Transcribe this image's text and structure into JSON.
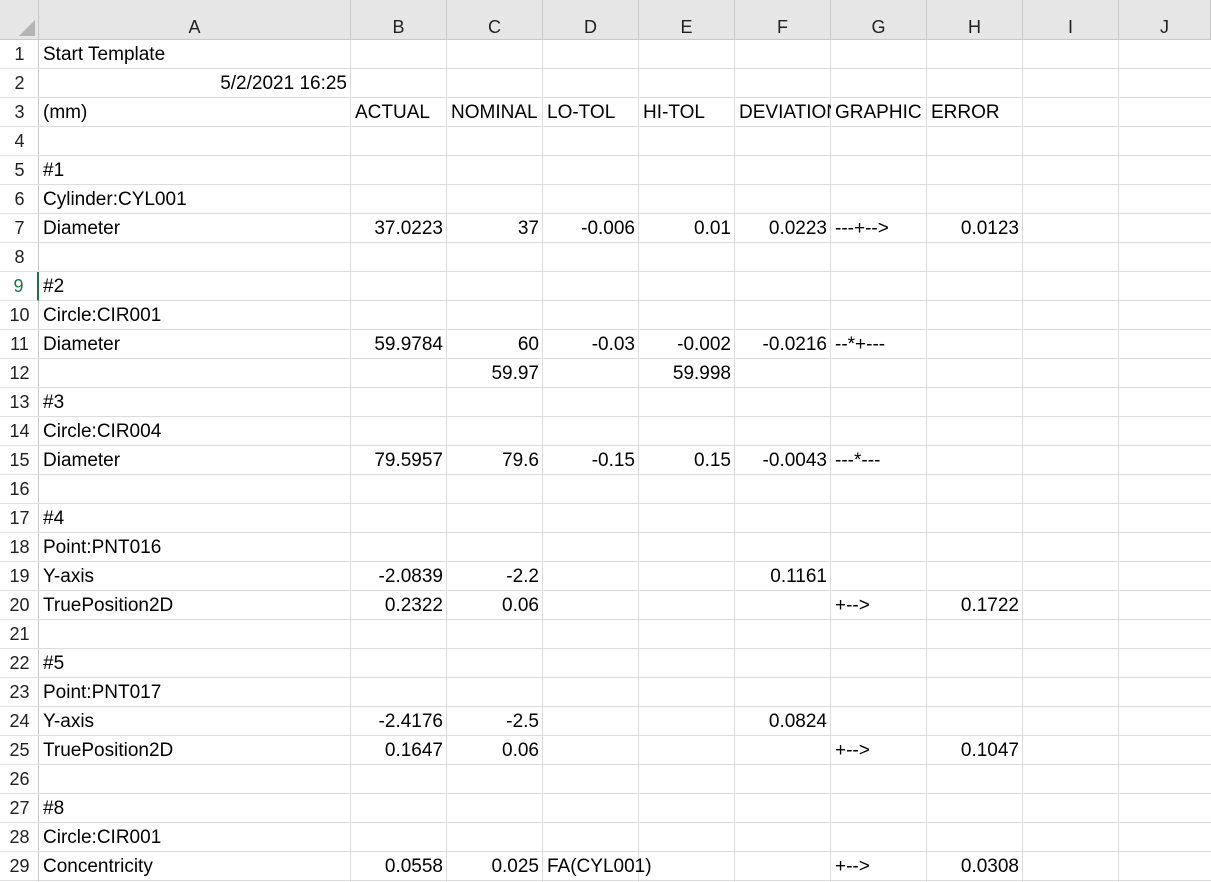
{
  "columns": [
    "A",
    "B",
    "C",
    "D",
    "E",
    "F",
    "G",
    "H",
    "I",
    "J"
  ],
  "row_numbers": [
    "1",
    "2",
    "3",
    "4",
    "5",
    "6",
    "7",
    "8",
    "9",
    "10",
    "11",
    "12",
    "13",
    "14",
    "15",
    "16",
    "17",
    "18",
    "19",
    "20",
    "21",
    "22",
    "23",
    "24",
    "25",
    "26",
    "27",
    "28",
    "29"
  ],
  "selected_row": "9",
  "cells": {
    "A1": "Start Template",
    "A2": "5/2/2021 16:25",
    "A3": "(mm)",
    "B3": "ACTUAL",
    "C3": "NOMINAL",
    "D3": "LO-TOL",
    "E3": "HI-TOL",
    "F3": "DEVIATION",
    "G3": "GRAPHIC",
    "H3": "ERROR",
    "A5": "#1",
    "A6": "Cylinder:CYL001",
    "A7": "Diameter",
    "B7": "37.0223",
    "C7": "37",
    "D7": "-0.006",
    "E7": "0.01",
    "F7": "0.0223",
    "G7": "---+-->",
    "H7": "0.0123",
    "A9": "#2",
    "A10": "Circle:CIR001",
    "A11": "Diameter",
    "B11": "59.9784",
    "C11": "60",
    "D11": "-0.03",
    "E11": "-0.002",
    "F11": "-0.0216",
    "G11": "--*+---",
    "C12": "59.97",
    "E12": "59.998",
    "A13": "#3",
    "A14": "Circle:CIR004",
    "A15": "Diameter",
    "B15": "79.5957",
    "C15": "79.6",
    "D15": "-0.15",
    "E15": "0.15",
    "F15": "-0.0043",
    "G15": "---*---",
    "A17": "#4",
    "A18": "Point:PNT016",
    "A19": "Y-axis",
    "B19": "-2.0839",
    "C19": "-2.2",
    "F19": "0.1161",
    "A20": "TruePosition2D",
    "B20": "0.2322",
    "C20": "0.06",
    "G20": "+-->",
    "H20": "0.1722",
    "A22": "#5",
    "A23": "Point:PNT017",
    "A24": "Y-axis",
    "B24": "-2.4176",
    "C24": "-2.5",
    "F24": "0.0824",
    "A25": "TruePosition2D",
    "B25": "0.1647",
    "C25": "0.06",
    "G25": "+-->",
    "H25": "0.1047",
    "A27": "#8",
    "A28": "Circle:CIR001",
    "A29": "Concentricity",
    "B29": "0.0558",
    "C29": "0.025",
    "D29": "FA(CYL001)",
    "G29": "+-->",
    "H29": "0.0308"
  },
  "right_aligned_cells": [
    "A2",
    "B7",
    "C7",
    "D7",
    "E7",
    "F7",
    "H7",
    "B11",
    "C11",
    "D11",
    "E11",
    "F11",
    "C12",
    "E12",
    "B15",
    "C15",
    "D15",
    "E15",
    "F15",
    "B19",
    "C19",
    "F19",
    "B20",
    "C20",
    "H20",
    "B24",
    "C24",
    "F24",
    "B25",
    "C25",
    "H25",
    "B29",
    "C29",
    "H29"
  ],
  "colors": {
    "header_bg": "#e6e6e6",
    "gridline": "#dcdcdc",
    "selection_accent": "#217346"
  }
}
